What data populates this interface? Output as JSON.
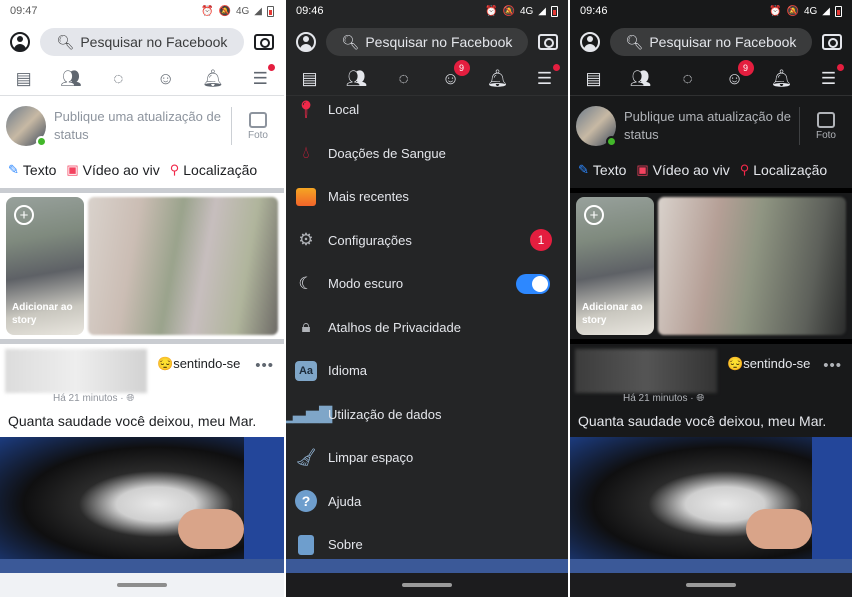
{
  "colors": {
    "fb_blue": "#3b5998",
    "notification_red": "#e41e3f",
    "toggle_blue": "#2d88ff",
    "online_green": "#42b72a"
  },
  "screens": {
    "light": {
      "time": "09:47",
      "network": "4G",
      "search_placeholder": "Pesquisar no Facebook",
      "composer": {
        "prompt": "Publique uma atualização de status",
        "photo_label": "Foto"
      },
      "actions": {
        "text": "Texto",
        "live": "Vídeo ao viv",
        "location": "Localização"
      },
      "stories": {
        "add_label": "Adicionar ao story"
      },
      "post": {
        "feeling": "sentindo-se",
        "time": "Há 21 minutos",
        "more": "•••",
        "text": "Quanta saudade você deixou, meu Mar."
      }
    },
    "menu": {
      "time": "09:46",
      "network": "4G",
      "search_placeholder": "Pesquisar no Facebook",
      "groups_badge": "9",
      "items": [
        {
          "label": "Local",
          "icon": "location-pin-icon"
        },
        {
          "label": "Doações de Sangue",
          "icon": "blood-drop-icon"
        },
        {
          "label": "Mais recentes",
          "icon": "recent-feed-icon"
        },
        {
          "label": "Configurações",
          "icon": "gear-icon",
          "badge": "1"
        },
        {
          "label": "Modo escuro",
          "icon": "moon-icon",
          "toggle": true
        },
        {
          "label": "Atalhos de Privacidade",
          "icon": "lock-icon"
        },
        {
          "label": "Idioma",
          "icon": "language-icon",
          "glyph": "Aa"
        },
        {
          "label": "Utilização de dados",
          "icon": "data-usage-icon"
        },
        {
          "label": "Limpar espaço",
          "icon": "broom-icon"
        },
        {
          "label": "Ajuda",
          "icon": "help-icon",
          "glyph": "?"
        },
        {
          "label": "Sobre",
          "icon": "about-icon"
        }
      ]
    },
    "dark": {
      "time": "09:46",
      "network": "4G",
      "search_placeholder": "Pesquisar no Facebook",
      "groups_badge": "9",
      "composer": {
        "prompt": "Publique uma atualização de status",
        "photo_label": "Foto"
      },
      "actions": {
        "text": "Texto",
        "live": "Vídeo ao viv",
        "location": "Localização"
      },
      "stories": {
        "add_label": "Adicionar ao story"
      },
      "post": {
        "feeling": "sentindo-se",
        "time": "Há 21 minutos",
        "more": "•••",
        "text": "Quanta saudade você deixou, meu Mar."
      }
    }
  }
}
